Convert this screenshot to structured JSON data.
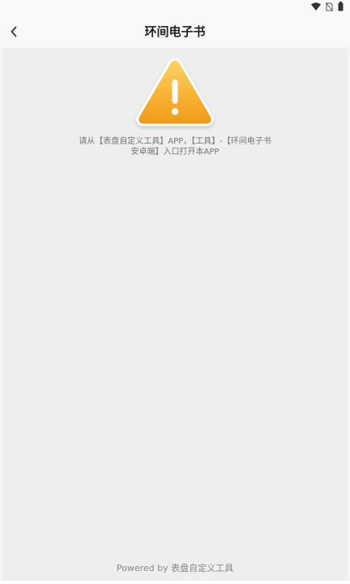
{
  "header": {
    "title": "环间电子书",
    "back_icon": "chevron-left-icon"
  },
  "status_bar": {
    "icons": [
      "wifi-icon",
      "no-sim-icon",
      "battery-icon"
    ]
  },
  "alert": {
    "icon": "warning-triangle-icon",
    "icon_color": "#f6a623",
    "message_line1": "请从【表盘自定义工具】APP，【工具】-【环间电子书",
    "message_line2": "安卓端】入口打开本APP"
  },
  "footer": {
    "text": "Powered by 表盘自定义工具"
  }
}
